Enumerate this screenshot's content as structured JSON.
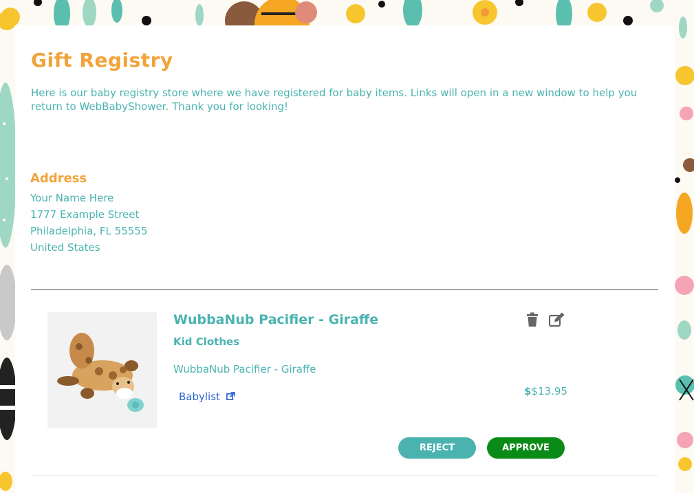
{
  "page": {
    "title": "Gift Registry",
    "intro": "Here is our baby registry store where we have registered for baby items. Links will open in a new window to help you return to WebBabyShower. Thank you for looking!"
  },
  "address": {
    "heading": "Address",
    "lines": [
      "Your Name Here",
      "1777 Example Street",
      "Philadelphia, FL 55555",
      "United States"
    ]
  },
  "item": {
    "title": "WubbaNub Pacifier - Giraffe",
    "category": "Kid Clothes",
    "description": "WubbaNub Pacifier - Giraffe",
    "store_link": "Babylist",
    "price_currency": "$",
    "price": "$13.95",
    "image_icon": "giraffe-pacifier-image",
    "delete_icon": "trash-icon",
    "edit_icon": "edit-icon",
    "external_icon": "external-link-icon"
  },
  "actions": {
    "reject": "REJECT",
    "approve": "APPROVE"
  },
  "colors": {
    "accent_orange": "#f2a33a",
    "accent_teal": "#4ab3b0",
    "approve_green": "#0a8a16",
    "link_blue": "#2d63d3"
  }
}
